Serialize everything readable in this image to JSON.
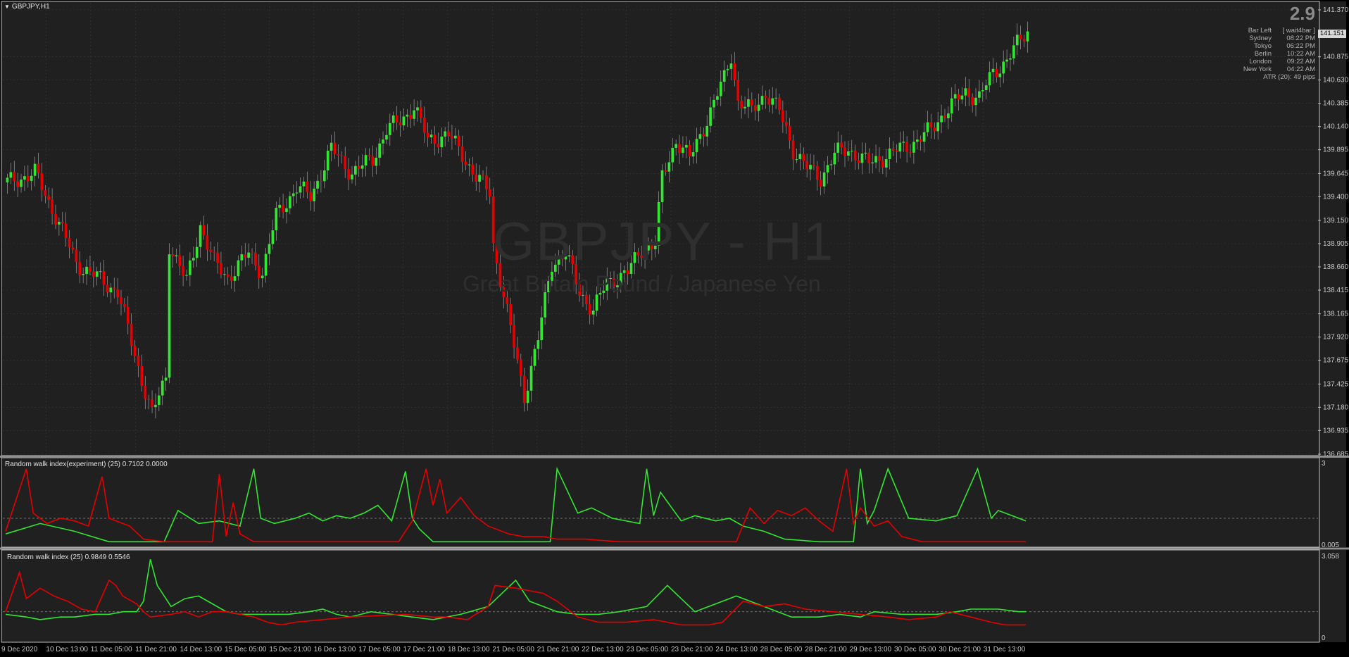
{
  "symbol_title": "GBPJPY,H1",
  "watermark": {
    "symbol": "GBPJPY - H1",
    "description": "Great Britain Pound / Japanese Yen"
  },
  "countdown": "2.9",
  "current_price": "141.151",
  "info_panel": [
    {
      "name": "Bar Left",
      "value": "[ wait4bar ]"
    },
    {
      "name": "Sydney",
      "value": "08:22 PM"
    },
    {
      "name": "Tokyo",
      "value": "06:22 PM"
    },
    {
      "name": "Berlin",
      "value": "10:22 AM"
    },
    {
      "name": "London",
      "value": "09:22 AM"
    },
    {
      "name": "New York",
      "value": "04:22 AM"
    }
  ],
  "atr_text": "ATR (20): 49 pips",
  "indicator1": {
    "title": "Random walk index(experiment) (25) 0.7102 0.0000",
    "max_label": "3",
    "min_label": "0.005"
  },
  "indicator2": {
    "title": "Random walk index (25) 0.9849 0.5546",
    "max_label": "3.058",
    "min_label": "0"
  },
  "colors": {
    "background": "#202020",
    "grid": "#3a3a3a",
    "bull": "#32e632",
    "bear": "#e60000",
    "wick": "#b4b4b4",
    "frame": "#c0c0c0"
  },
  "chart_data": [
    {
      "type": "candlestick",
      "title": "GBPJPY,H1",
      "y_ticks": [
        "141.370",
        "140.875",
        "140.630",
        "140.385",
        "140.140",
        "139.895",
        "139.645",
        "139.400",
        "139.150",
        "138.905",
        "138.660",
        "138.415",
        "138.165",
        "137.920",
        "137.675",
        "137.425",
        "137.180",
        "136.935",
        "136.685"
      ],
      "ylim": [
        136.685,
        141.37
      ],
      "x_ticks": [
        "9 Dec 2020",
        "10 Dec 13:00",
        "11 Dec 05:00",
        "11 Dec 21:00",
        "14 Dec 13:00",
        "15 Dec 05:00",
        "15 Dec 21:00",
        "16 Dec 13:00",
        "17 Dec 05:00",
        "17 Dec 21:00",
        "18 Dec 13:00",
        "21 Dec 05:00",
        "21 Dec 21:00",
        "22 Dec 13:00",
        "23 Dec 05:00",
        "23 Dec 21:00",
        "24 Dec 13:00",
        "28 Dec 05:00",
        "28 Dec 21:00",
        "29 Dec 13:00",
        "30 Dec 05:00",
        "30 Dec 21:00",
        "31 Dec 13:00"
      ],
      "close_path": [
        [
          0,
          139.55
        ],
        [
          8,
          139.65
        ],
        [
          14,
          139.2
        ],
        [
          20,
          138.7
        ],
        [
          26,
          138.55
        ],
        [
          32,
          138.4
        ],
        [
          38,
          137.6
        ],
        [
          42,
          137.1
        ],
        [
          46,
          137.5
        ],
        [
          47,
          138.9
        ],
        [
          52,
          138.5
        ],
        [
          56,
          139.1
        ],
        [
          60,
          138.7
        ],
        [
          64,
          138.55
        ],
        [
          70,
          138.8
        ],
        [
          74,
          138.6
        ],
        [
          78,
          139.2
        ],
        [
          84,
          139.5
        ],
        [
          88,
          139.4
        ],
        [
          94,
          139.9
        ],
        [
          100,
          139.65
        ],
        [
          106,
          139.8
        ],
        [
          110,
          140.1
        ],
        [
          114,
          140.2
        ],
        [
          118,
          140.35
        ],
        [
          122,
          140.0
        ],
        [
          128,
          140.05
        ],
        [
          132,
          139.85
        ],
        [
          136,
          139.6
        ],
        [
          140,
          139.45
        ],
        [
          141,
          138.9
        ],
        [
          146,
          138.0
        ],
        [
          150,
          137.3
        ],
        [
          154,
          137.9
        ],
        [
          158,
          138.7
        ],
        [
          162,
          138.8
        ],
        [
          166,
          138.4
        ],
        [
          170,
          138.2
        ],
        [
          174,
          138.5
        ],
        [
          180,
          138.6
        ],
        [
          184,
          138.85
        ],
        [
          188,
          138.9
        ],
        [
          190,
          139.6
        ],
        [
          194,
          140.0
        ],
        [
          198,
          139.8
        ],
        [
          204,
          140.3
        ],
        [
          208,
          140.65
        ],
        [
          210,
          140.9
        ],
        [
          212,
          140.4
        ],
        [
          216,
          140.3
        ],
        [
          220,
          140.5
        ],
        [
          224,
          140.3
        ],
        [
          228,
          139.9
        ],
        [
          232,
          139.7
        ],
        [
          236,
          139.6
        ],
        [
          240,
          139.85
        ],
        [
          244,
          139.9
        ],
        [
          250,
          139.75
        ],
        [
          256,
          139.85
        ],
        [
          262,
          139.95
        ],
        [
          268,
          140.1
        ],
        [
          272,
          140.3
        ],
        [
          278,
          140.5
        ],
        [
          282,
          140.45
        ],
        [
          286,
          140.7
        ],
        [
          290,
          140.85
        ],
        [
          296,
          141.15
        ]
      ]
    },
    {
      "type": "line",
      "title": "Random walk index(experiment) (25)",
      "values_in_title": [
        0.7102,
        0.0
      ],
      "ylim": [
        0,
        3
      ],
      "series": [
        {
          "color": "#32e632",
          "x": [
            0,
            10,
            20,
            30,
            38,
            42,
            46,
            50,
            56,
            62,
            68,
            72,
            74,
            78,
            84,
            88,
            92,
            96,
            100,
            104,
            108,
            112,
            116,
            118,
            120,
            124,
            128,
            132,
            140,
            150,
            158,
            160,
            166,
            170,
            176,
            184,
            186,
            188,
            190,
            196,
            200,
            206,
            210,
            214,
            220,
            226,
            236,
            242,
            246,
            248,
            250,
            252,
            256,
            262,
            270,
            276,
            282,
            286,
            288,
            292,
            296
          ],
          "y": [
            0.4,
            0.8,
            0.5,
            0.1,
            0.1,
            0.1,
            0.1,
            1.3,
            0.8,
            0.9,
            0.7,
            2.9,
            1.0,
            0.8,
            1.0,
            1.2,
            0.9,
            1.1,
            1.0,
            1.2,
            1.5,
            0.9,
            2.8,
            1.0,
            0.6,
            0.1,
            0.1,
            0.1,
            0.1,
            0.1,
            0.1,
            2.9,
            1.2,
            1.4,
            1.0,
            0.8,
            2.9,
            1.1,
            2.0,
            0.9,
            1.1,
            0.9,
            1.0,
            0.7,
            0.5,
            0.2,
            0.1,
            0.1,
            0.1,
            2.9,
            0.8,
            1.3,
            2.9,
            1.0,
            0.9,
            1.1,
            2.9,
            1.0,
            1.3,
            1.1,
            0.9
          ]
        },
        {
          "color": "#e60000",
          "x": [
            0,
            6,
            8,
            12,
            16,
            20,
            24,
            28,
            30,
            34,
            36,
            40,
            46,
            50,
            56,
            60,
            62,
            64,
            66,
            68,
            72,
            76,
            80,
            84,
            90,
            100,
            114,
            118,
            122,
            124,
            126,
            128,
            132,
            136,
            140,
            146,
            150,
            156,
            160,
            168,
            178,
            190,
            200,
            212,
            216,
            220,
            224,
            228,
            232,
            236,
            240,
            244,
            246,
            248,
            252,
            256,
            260,
            266,
            270,
            280,
            296
          ],
          "y": [
            0.5,
            2.9,
            1.2,
            0.8,
            1.0,
            0.9,
            0.7,
            2.6,
            1.0,
            0.8,
            0.7,
            0.2,
            0.1,
            0.1,
            0.1,
            0.1,
            2.7,
            0.3,
            1.6,
            0.4,
            0.1,
            0.1,
            0.1,
            0.1,
            0.1,
            0.1,
            0.1,
            0.9,
            2.9,
            1.5,
            2.5,
            1.2,
            1.8,
            1.1,
            0.7,
            0.4,
            0.3,
            0.3,
            0.2,
            0.2,
            0.1,
            0.1,
            0.1,
            0.1,
            1.4,
            0.8,
            1.3,
            1.1,
            1.4,
            0.9,
            0.5,
            2.9,
            0.8,
            1.4,
            0.7,
            0.9,
            0.3,
            0.1,
            0.1,
            0.1,
            0.1
          ]
        }
      ]
    },
    {
      "type": "line",
      "title": "Random walk index (25)",
      "values_in_title": [
        0.9849,
        0.5546
      ],
      "ylim": [
        0,
        3.058
      ],
      "series": [
        {
          "color": "#32e632",
          "x": [
            0,
            6,
            10,
            16,
            20,
            26,
            30,
            34,
            38,
            40,
            42,
            44,
            48,
            52,
            56,
            60,
            64,
            68,
            72,
            76,
            82,
            88,
            92,
            96,
            100,
            106,
            112,
            118,
            124,
            128,
            132,
            140,
            148,
            152,
            156,
            160,
            166,
            172,
            178,
            186,
            192,
            196,
            200,
            204,
            212,
            220,
            228,
            236,
            242,
            248,
            252,
            260,
            270,
            276,
            280,
            288,
            294,
            296
          ],
          "y": [
            0.9,
            0.8,
            0.7,
            0.8,
            0.8,
            0.9,
            0.9,
            1.0,
            1.0,
            1.4,
            3.0,
            2.0,
            1.2,
            1.5,
            1.6,
            1.3,
            1.0,
            0.9,
            0.9,
            0.9,
            0.9,
            1.0,
            1.1,
            0.9,
            0.8,
            1.0,
            0.9,
            0.8,
            0.7,
            0.8,
            0.9,
            1.2,
            2.2,
            1.4,
            1.2,
            1.0,
            0.9,
            0.9,
            1.0,
            1.2,
            2.0,
            1.5,
            1.0,
            1.2,
            1.6,
            1.2,
            0.8,
            0.8,
            0.9,
            0.8,
            1.0,
            0.9,
            0.9,
            1.0,
            1.1,
            1.1,
            1.0,
            1.0
          ]
        },
        {
          "color": "#e60000",
          "x": [
            0,
            4,
            6,
            10,
            14,
            18,
            22,
            26,
            30,
            32,
            34,
            38,
            40,
            42,
            48,
            52,
            56,
            60,
            64,
            68,
            72,
            76,
            80,
            84,
            100,
            116,
            124,
            128,
            134,
            140,
            142,
            148,
            152,
            156,
            160,
            166,
            172,
            180,
            188,
            196,
            200,
            204,
            208,
            214,
            220,
            226,
            232,
            240,
            248,
            256,
            262,
            270,
            274,
            280,
            286,
            290,
            296
          ],
          "y": [
            1.0,
            2.5,
            1.5,
            1.9,
            1.6,
            1.4,
            1.1,
            1.0,
            2.2,
            2.0,
            1.6,
            1.3,
            1.0,
            0.8,
            0.9,
            1.0,
            0.8,
            1.0,
            1.0,
            0.9,
            0.8,
            0.6,
            0.5,
            0.6,
            0.8,
            0.9,
            0.8,
            0.8,
            0.7,
            1.2,
            2.0,
            1.9,
            1.8,
            1.7,
            1.4,
            0.8,
            0.6,
            0.6,
            0.7,
            0.5,
            0.5,
            0.5,
            0.6,
            1.4,
            1.2,
            1.3,
            1.1,
            1.0,
            0.9,
            0.8,
            0.7,
            0.8,
            1.0,
            0.8,
            0.6,
            0.5,
            0.5
          ]
        }
      ]
    }
  ]
}
